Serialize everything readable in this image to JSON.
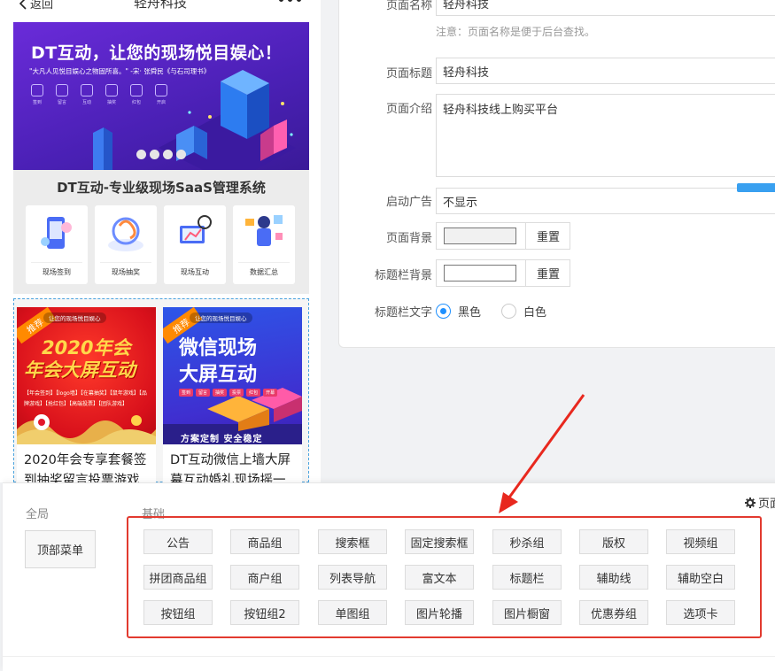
{
  "phone": {
    "back_label": "返回",
    "title": "轻舟科技",
    "banner": {
      "headline": "DT互动，让您的现场悦目娱心！",
      "quote": "\"大凡人见悦目娱心之物固所喜。\" -宋· 张舜民《与石司理书》",
      "icons": [
        "签到",
        "留言",
        "互动",
        "抽奖",
        "红包",
        "开启"
      ],
      "dots": 4
    },
    "section_title": "DT互动-专业级现场SaaS管理系统",
    "cards": [
      "现场签到",
      "现场抽奖",
      "现场互动",
      "数据汇总"
    ],
    "promos": [
      {
        "tag": "推荐",
        "sub": "让您的现场悦目娱心",
        "line1": "2020年会",
        "line2": "年会大屏互动",
        "small": "【年会签到】【logo墙】【在幕抽奖】【鼠年游戏】【品牌游戏】【抢红包】【高端投票】【团队游戏】",
        "title1": "2020年会专享套餐签",
        "title2": "到抽奖留言投票游戏"
      },
      {
        "tag": "推荐",
        "sub": "让您的现场悦目娱心",
        "line1": "微信现场",
        "line2": "大屏互动",
        "chips": [
          "签到",
          "留言",
          "抽奖",
          "投票",
          "红包",
          "开幕"
        ],
        "foot": "方案定制 安全稳定",
        "title1": "DT互动微信上墙大屏",
        "title2": "幕互动婚礼现场摇一"
      }
    ]
  },
  "settings": {
    "page_name_label": "页面名称",
    "page_name_value": "轻舟科技",
    "page_name_note": "注意：页面名称是便于后台查找。",
    "page_title_label": "页面标题",
    "page_title_value": "轻舟科技",
    "page_intro_label": "页面介绍",
    "page_intro_value": "轻舟科技线上购买平台",
    "ad_label": "启动广告",
    "ad_value": "不显示",
    "bg_label": "页面背景",
    "bg_color": "#f1f1f1",
    "reset_label": "重置",
    "titlebar_bg_label": "标题栏背景",
    "titlebar_bg_color": "#ffffff",
    "titlebar_text_label": "标题栏文字",
    "radio_black": "黑色",
    "radio_white": "白色",
    "selected": "black"
  },
  "drawer": {
    "global_label": "全局",
    "basic_label": "基础",
    "page_settings": "页面",
    "top_menu": "顶部菜单",
    "components": [
      [
        "公告",
        "商品组",
        "搜索框",
        "固定搜索框",
        "秒杀组",
        "版权",
        "视频组"
      ],
      [
        "拼团商品组",
        "商户组",
        "列表导航",
        "富文本",
        "标题栏",
        "辅助线",
        "辅助空白"
      ],
      [
        "按钮组",
        "按钮组2",
        "单图组",
        "图片轮播",
        "图片橱窗",
        "优惠券组",
        "选项卡"
      ]
    ]
  },
  "colors": {
    "accent": "#1e90ff",
    "highlight": "#e23a2f",
    "banner": "#5526c8"
  }
}
